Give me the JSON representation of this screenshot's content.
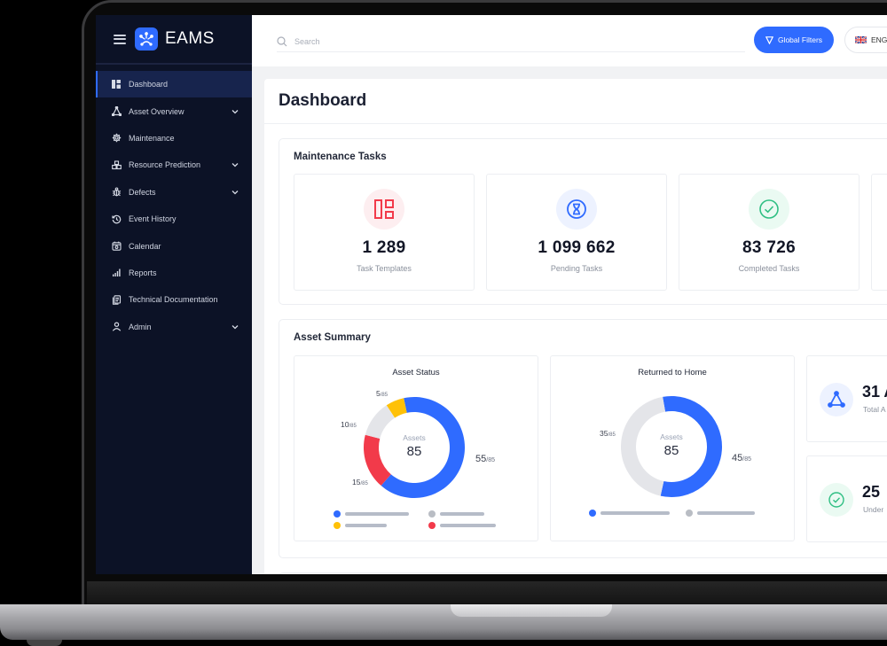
{
  "app": {
    "name": "EAMS"
  },
  "sidebar": {
    "items": [
      {
        "label": "Dashboard",
        "icon": "dashboard-icon",
        "active": true,
        "expandable": false
      },
      {
        "label": "Asset Overview",
        "icon": "triangle-nodes-icon",
        "active": false,
        "expandable": true
      },
      {
        "label": "Maintenance",
        "icon": "gear-icon",
        "active": false,
        "expandable": false
      },
      {
        "label": "Resource Prediction",
        "icon": "boxes-icon",
        "active": false,
        "expandable": true
      },
      {
        "label": "Defects",
        "icon": "bug-icon",
        "active": false,
        "expandable": true
      },
      {
        "label": "Event History",
        "icon": "history-icon",
        "active": false,
        "expandable": false
      },
      {
        "label": "Calendar",
        "icon": "calendar-icon",
        "active": false,
        "expandable": false
      },
      {
        "label": "Reports",
        "icon": "bar-chart-icon",
        "active": false,
        "expandable": false
      },
      {
        "label": "Technical Documentation",
        "icon": "document-icon",
        "active": false,
        "expandable": false
      },
      {
        "label": "Admin",
        "icon": "user-icon",
        "active": false,
        "expandable": true
      }
    ]
  },
  "topbar": {
    "search_placeholder": "Search",
    "filters_label": "Global Filters",
    "language": "ENG"
  },
  "page": {
    "title": "Dashboard"
  },
  "maintenance": {
    "title": "Maintenance Tasks",
    "cards": [
      {
        "value": "1 289",
        "label": "Task Templates",
        "icon": "layout-icon",
        "color": "#f23a4a",
        "bg": "#fdeef0"
      },
      {
        "value": "1 099 662",
        "label": "Pending Tasks",
        "icon": "hourglass-icon",
        "color": "#2f6bff",
        "bg": "#edf2ff"
      },
      {
        "value": "83 726",
        "label": "Completed Tasks",
        "icon": "check-circle-icon",
        "color": "#2fbf83",
        "bg": "#eafaf2"
      }
    ]
  },
  "asset_summary": {
    "title": "Asset Summary",
    "center_label": "Assets",
    "total_suffix": "/85",
    "mini_cards": [
      {
        "value": "31 A",
        "label": "Total A",
        "icon": "triangle-nodes-icon",
        "color": "#2f6bff",
        "bg": "#edf2ff"
      },
      {
        "value": "25",
        "label": "Under",
        "icon": "check-circle-icon",
        "color": "#2fbf83",
        "bg": "#eafaf2"
      }
    ]
  },
  "colors": {
    "accent": "#2f6bff",
    "yellow": "#ffc107",
    "red": "#f23a4a",
    "gray": "#e5e7eb",
    "sidebar_bg": "#0c1226"
  },
  "chart_data": [
    {
      "type": "pie",
      "title": "Asset Status",
      "total": 85,
      "center_label": "Assets",
      "center_value": "85",
      "series": [
        {
          "name": "blue",
          "value": 55,
          "color": "#2f6bff",
          "label": "55"
        },
        {
          "name": "red",
          "value": 15,
          "color": "#f23a4a",
          "label": "15"
        },
        {
          "name": "gray",
          "value": 10,
          "color": "#e4e5e9",
          "label": "10"
        },
        {
          "name": "yellow",
          "value": 5,
          "color": "#ffc107",
          "label": "5"
        }
      ],
      "legend": [
        {
          "color": "#2f6bff"
        },
        {
          "color": "#b9bdc4"
        },
        {
          "color": "#ffc107"
        },
        {
          "color": "#f23a4a"
        }
      ]
    },
    {
      "type": "pie",
      "title": "Returned to Home",
      "total": 85,
      "center_label": "Assets",
      "center_value": "85",
      "series": [
        {
          "name": "blue",
          "value": 45,
          "color": "#2f6bff",
          "label": "45"
        },
        {
          "name": "gray",
          "value": 35,
          "color": "#e4e5e9",
          "label": "35"
        }
      ],
      "legend": [
        {
          "color": "#2f6bff"
        },
        {
          "color": "#b9bdc4"
        }
      ]
    }
  ]
}
